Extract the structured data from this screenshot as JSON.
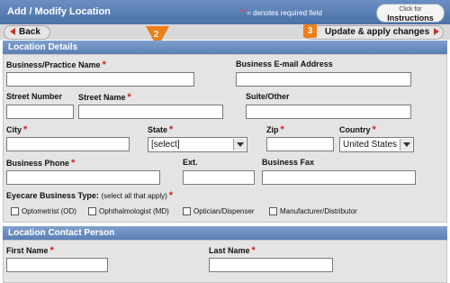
{
  "header": {
    "title": "Add / Modify Location",
    "required_star": "*",
    "required_note": "= denotes required field",
    "help_small": "Click for",
    "help_big": "Instructions"
  },
  "toolbar": {
    "back_label": "Back",
    "update_label": "Update & apply changes",
    "step2": "2",
    "step3": "3"
  },
  "location_details": {
    "heading": "Location Details",
    "business_name": "Business/Practice Name",
    "business_email": "Business E-mail Address",
    "street_number": "Street Number",
    "street_name": "Street Name",
    "suite": "Suite/Other",
    "city": "City",
    "state": "State",
    "state_value": "[select]",
    "zip": "Zip",
    "country": "Country",
    "country_value": "United States",
    "phone": "Business Phone",
    "ext": "Ext.",
    "fax": "Business Fax",
    "type_label": "Eyecare Business Type:",
    "type_note": "(select all that apply)",
    "types": [
      "Optometrist (OD)",
      "Ophthalmologist (MD)",
      "Optician/Dispenser",
      "Manufacturer/Distributor"
    ]
  },
  "contact": {
    "heading": "Location Contact Person",
    "first_name": "First Name",
    "last_name": "Last Name"
  }
}
